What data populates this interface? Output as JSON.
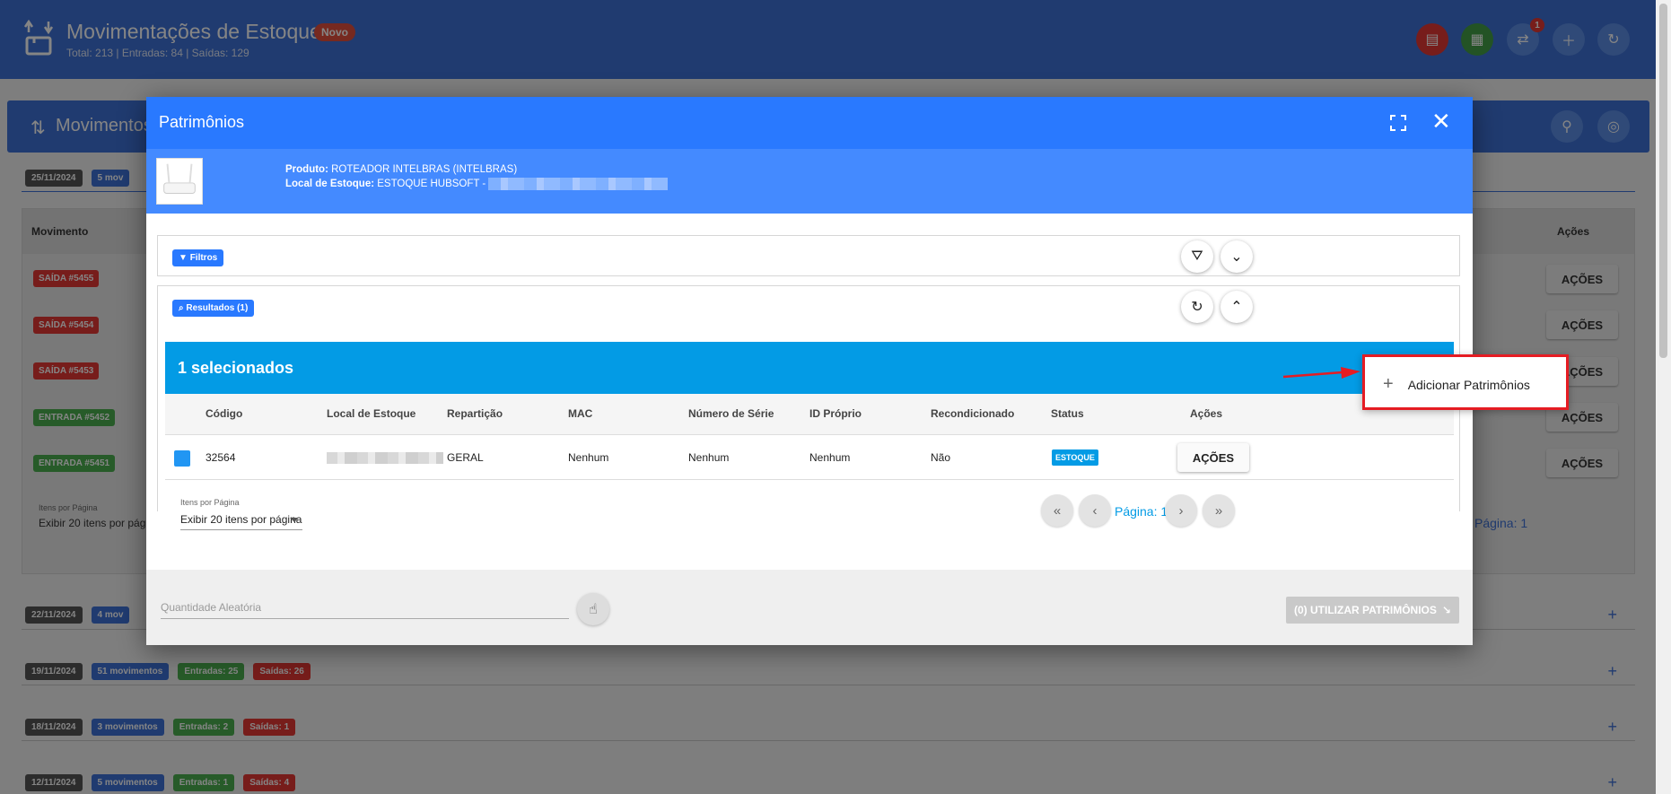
{
  "header": {
    "title": "Movimentações de Estoque",
    "badge": "Novo",
    "subtitle": "Total: 213 | Entradas: 84 | Saídas: 129",
    "notification_count": "1"
  },
  "subbar": {
    "label": "Movimentos"
  },
  "background": {
    "rows": [
      {
        "date": "25/11/2024",
        "movements": "5 mov"
      },
      {
        "date": "22/11/2024",
        "movements": "4 mov"
      },
      {
        "date": "19/11/2024",
        "movements": "51 movimentos",
        "entradas": "Entradas: 25",
        "saidas": "Saídas: 26"
      },
      {
        "date": "18/11/2024",
        "movements": "3 movimentos",
        "entradas": "Entradas: 2",
        "saidas": "Saídas: 1"
      },
      {
        "date": "12/11/2024",
        "movements": "5 movimentos",
        "entradas": "Entradas: 1",
        "saidas": "Saídas: 4"
      }
    ],
    "table": {
      "col_movimento": "Movimento",
      "col_acoes": "Ações",
      "items": [
        "SAÍDA #5455",
        "SAÍDA #5454",
        "SAÍDA #5453",
        "ENTRADA #5452",
        "ENTRADA #5451"
      ],
      "acoes_label": "AÇÕES",
      "ipp_label": "Itens por Página",
      "ipp_value": "Exibir 20 itens por págin",
      "page_label": "Página: 1"
    }
  },
  "modal": {
    "title": "Patrimônios",
    "product_label": "Produto:",
    "product_value": "ROTEADOR INTELBRAS (INTELBRAS)",
    "local_label": "Local de Estoque:",
    "local_value": "ESTOQUE HUBSOFT -",
    "filters_label": "Filtros",
    "results_label": "Resultados (1)",
    "selected_label": "1 selecionados",
    "columns": [
      "Código",
      "Local de Estoque",
      "Repartição",
      "MAC",
      "Número de Série",
      "ID Próprio",
      "Recondicionado",
      "Status",
      "Ações"
    ],
    "row": {
      "codigo": "32564",
      "reparticao": "GERAL",
      "mac": "Nenhum",
      "serie": "Nenhum",
      "id_proprio": "Nenhum",
      "recondicionado": "Não",
      "status": "ESTOQUE",
      "acoes": "AÇÕES"
    },
    "items_per_page_label": "Itens por Página",
    "items_per_page_value": "Exibir 20 itens por página",
    "page_label": "Página: 1",
    "quantity_placeholder": "Quantidade Aleatória",
    "use_button": "(0) UTILIZAR PATRIMÔNIOS",
    "dropdown_item": "Adicionar Patrimônios"
  },
  "colors": {
    "primary": "#3f71d6",
    "modal_header": "#2979ff",
    "selection_bar": "#039be5",
    "highlight": "#e51c23"
  }
}
